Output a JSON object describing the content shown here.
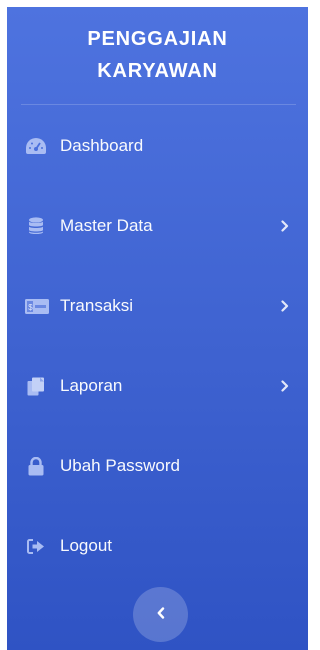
{
  "brand": {
    "line1": "PENGGAJIAN",
    "line2": "KARYAWAN"
  },
  "nav": [
    {
      "label": "Dashboard",
      "icon": "dashboard-gauge-icon",
      "has_submenu": false
    },
    {
      "label": "Master Data",
      "icon": "database-icon",
      "has_submenu": true
    },
    {
      "label": "Transaksi",
      "icon": "money-bill-icon",
      "has_submenu": true
    },
    {
      "label": "Laporan",
      "icon": "copy-files-icon",
      "has_submenu": true
    },
    {
      "label": "Ubah Password",
      "icon": "lock-icon",
      "has_submenu": false
    },
    {
      "label": "Logout",
      "icon": "sign-out-icon",
      "has_submenu": false
    }
  ],
  "toggle": {
    "icon": "chevron-left-icon"
  },
  "colors": {
    "sidebar_top": "#4e73df",
    "sidebar_bottom": "#2f53c4",
    "icon_muted": "#a9bcf3"
  }
}
